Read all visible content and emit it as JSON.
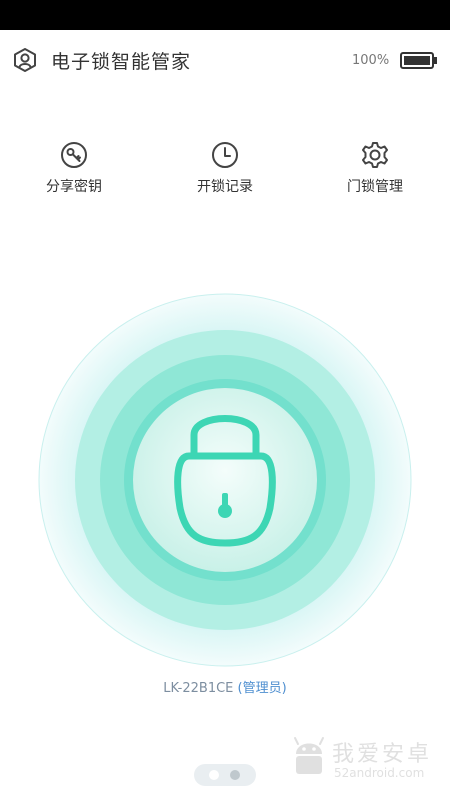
{
  "header": {
    "title": "电子锁智能管家",
    "battery_percent": "100%",
    "profile_icon": "user-shield-icon",
    "battery_icon": "battery-full-icon"
  },
  "features": [
    {
      "label": "分享密钥",
      "icon": "key-icon"
    },
    {
      "label": "开锁记录",
      "icon": "clock-icon"
    },
    {
      "label": "门锁管理",
      "icon": "gear-icon"
    }
  ],
  "lock_button": {
    "icon": "padlock-icon"
  },
  "device": {
    "id": "LK-22B1CE",
    "role": "(管理员)"
  },
  "pager": {
    "pages": 2,
    "current": 1
  },
  "watermark": {
    "text": "我爱安卓",
    "url": "52android.com"
  },
  "colors": {
    "accent": "#3dd6b4",
    "ring_outer": "#dff7f6",
    "ring_mid": "#c4f2ea",
    "ring_inner": "#8ee6d6",
    "center": "#e8f9f6",
    "device_id": "#7d8ea0",
    "device_role": "#4f8fd0"
  }
}
